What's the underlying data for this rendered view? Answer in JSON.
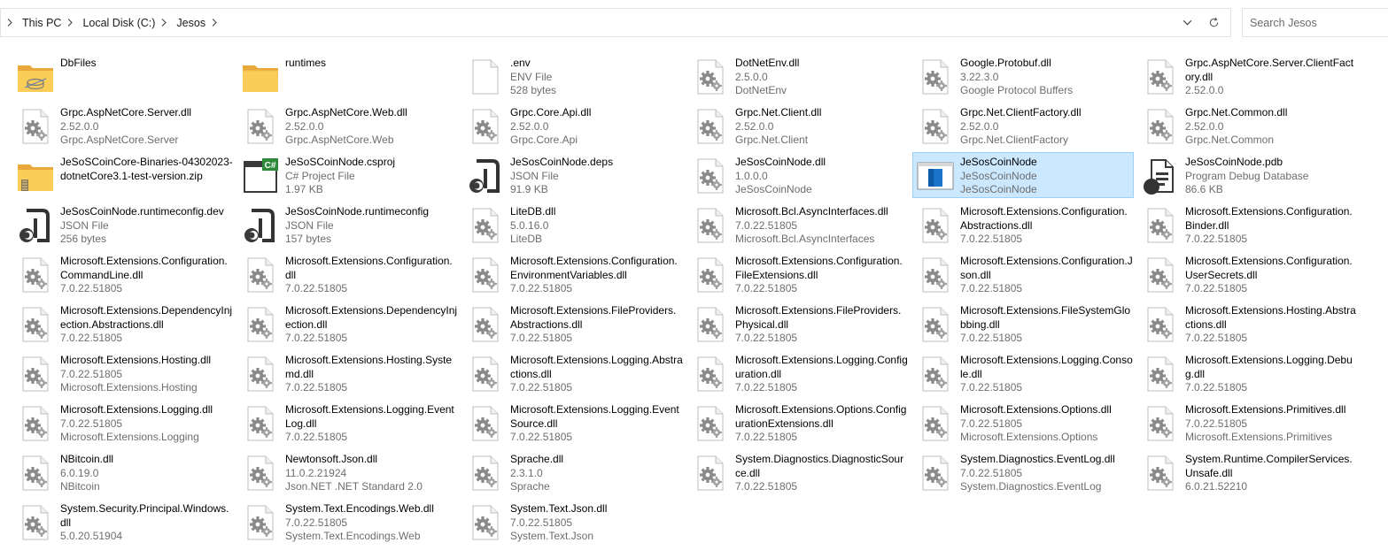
{
  "address": {
    "crumbs": [
      "This PC",
      "Local Disk (C:)",
      "Jesos"
    ],
    "dropdown_icon": "chevron-down-icon",
    "refresh_icon": "refresh-icon"
  },
  "search": {
    "placeholder": "Search Jesos"
  },
  "colors": {
    "selected_bg": "#cce8ff",
    "selected_border": "#99d1ff",
    "folder": "#f5c443",
    "csharp": "#2f8b3a"
  },
  "items": [
    {
      "name": "DbFiles",
      "line2": "",
      "line3": "",
      "icon": "folder-db",
      "iconname": "database-folder-icon"
    },
    {
      "name": "runtimes",
      "line2": "",
      "line3": "",
      "icon": "folder",
      "iconname": "folder-icon"
    },
    {
      "name": ".env",
      "line2": "ENV File",
      "line3": "528 bytes",
      "icon": "blank",
      "iconname": "file-icon"
    },
    {
      "name": "DotNetEnv.dll",
      "line2": "2.5.0.0",
      "line3": "DotNetEnv",
      "icon": "dll",
      "iconname": "dll-gear-icon"
    },
    {
      "name": "Google.Protobuf.dll",
      "line2": "3.22.3.0",
      "line3": "Google Protocol Buffers",
      "icon": "dll",
      "iconname": "dll-gear-icon"
    },
    {
      "name": "Grpc.AspNetCore.Server.ClientFactory.dll",
      "line2": "2.52.0.0",
      "line3": "",
      "icon": "dll",
      "iconname": "dll-gear-icon"
    },
    {
      "name": "Grpc.AspNetCore.Server.dll",
      "line2": "2.52.0.0",
      "line3": "Grpc.AspNetCore.Server",
      "icon": "dll",
      "iconname": "dll-gear-icon"
    },
    {
      "name": "Grpc.AspNetCore.Web.dll",
      "line2": "2.52.0.0",
      "line3": "Grpc.AspNetCore.Web",
      "icon": "dll",
      "iconname": "dll-gear-icon"
    },
    {
      "name": "Grpc.Core.Api.dll",
      "line2": "2.52.0.0",
      "line3": "Grpc.Core.Api",
      "icon": "dll",
      "iconname": "dll-gear-icon"
    },
    {
      "name": "Grpc.Net.Client.dll",
      "line2": "2.52.0.0",
      "line3": "Grpc.Net.Client",
      "icon": "dll",
      "iconname": "dll-gear-icon"
    },
    {
      "name": "Grpc.Net.ClientFactory.dll",
      "line2": "2.52.0.0",
      "line3": "Grpc.Net.ClientFactory",
      "icon": "dll",
      "iconname": "dll-gear-icon"
    },
    {
      "name": "Grpc.Net.Common.dll",
      "line2": "2.52.0.0",
      "line3": "Grpc.Net.Common",
      "icon": "dll",
      "iconname": "dll-gear-icon"
    },
    {
      "name": "JeSoSCoinCore-Binaries-04302023-dotnetCore3.1-test-version.zip",
      "line2": "",
      "line3": "",
      "icon": "zip",
      "iconname": "zip-folder-icon"
    },
    {
      "name": "JeSoSCoinNode.csproj",
      "line2": "C# Project File",
      "line3": "1.97 KB",
      "icon": "csproj",
      "iconname": "csharp-project-icon"
    },
    {
      "name": "JeSosCoinNode.deps",
      "line2": "JSON File",
      "line3": "91.9 KB",
      "icon": "json",
      "iconname": "json-file-icon"
    },
    {
      "name": "JeSosCoinNode.dll",
      "line2": "1.0.0.0",
      "line3": "JeSosCoinNode",
      "icon": "dll",
      "iconname": "dll-gear-icon"
    },
    {
      "name": "JeSosCoinNode",
      "line2": "JeSosCoinNode",
      "line3": "JeSosCoinNode",
      "icon": "exe",
      "iconname": "application-icon",
      "selected": true
    },
    {
      "name": "JeSosCoinNode.pdb",
      "line2": "Program Debug Database",
      "line3": "86.6 KB",
      "icon": "pdb",
      "iconname": "pdb-file-icon"
    },
    {
      "name": "JeSosCoinNode.runtimeconfig.dev",
      "line2": "JSON File",
      "line3": "256 bytes",
      "icon": "json",
      "iconname": "json-file-icon"
    },
    {
      "name": "JeSosCoinNode.runtimeconfig",
      "line2": "JSON File",
      "line3": "157 bytes",
      "icon": "json",
      "iconname": "json-file-icon"
    },
    {
      "name": "LiteDB.dll",
      "line2": "5.0.16.0",
      "line3": "LiteDB",
      "icon": "dll",
      "iconname": "dll-gear-icon"
    },
    {
      "name": "Microsoft.Bcl.AsyncInterfaces.dll",
      "line2": "7.0.22.51805",
      "line3": "Microsoft.Bcl.AsyncInterfaces",
      "icon": "dll",
      "iconname": "dll-gear-icon"
    },
    {
      "name": "Microsoft.Extensions.Configuration.Abstractions.dll",
      "line2": "7.0.22.51805",
      "line3": "",
      "icon": "dll",
      "iconname": "dll-gear-icon"
    },
    {
      "name": "Microsoft.Extensions.Configuration.Binder.dll",
      "line2": "7.0.22.51805",
      "line3": "",
      "icon": "dll",
      "iconname": "dll-gear-icon"
    },
    {
      "name": "Microsoft.Extensions.Configuration.CommandLine.dll",
      "line2": "7.0.22.51805",
      "line3": "",
      "icon": "dll",
      "iconname": "dll-gear-icon"
    },
    {
      "name": "Microsoft.Extensions.Configuration.dll",
      "line2": "7.0.22.51805",
      "line3": "",
      "icon": "dll",
      "iconname": "dll-gear-icon"
    },
    {
      "name": "Microsoft.Extensions.Configuration.EnvironmentVariables.dll",
      "line2": "7.0.22.51805",
      "line3": "",
      "icon": "dll",
      "iconname": "dll-gear-icon"
    },
    {
      "name": "Microsoft.Extensions.Configuration.FileExtensions.dll",
      "line2": "7.0.22.51805",
      "line3": "",
      "icon": "dll",
      "iconname": "dll-gear-icon"
    },
    {
      "name": "Microsoft.Extensions.Configuration.Json.dll",
      "line2": "7.0.22.51805",
      "line3": "",
      "icon": "dll",
      "iconname": "dll-gear-icon"
    },
    {
      "name": "Microsoft.Extensions.Configuration.UserSecrets.dll",
      "line2": "7.0.22.51805",
      "line3": "",
      "icon": "dll",
      "iconname": "dll-gear-icon"
    },
    {
      "name": "Microsoft.Extensions.DependencyInjection.Abstractions.dll",
      "line2": "7.0.22.51805",
      "line3": "",
      "icon": "dll",
      "iconname": "dll-gear-icon"
    },
    {
      "name": "Microsoft.Extensions.DependencyInjection.dll",
      "line2": "7.0.22.51805",
      "line3": "",
      "icon": "dll",
      "iconname": "dll-gear-icon"
    },
    {
      "name": "Microsoft.Extensions.FileProviders.Abstractions.dll",
      "line2": "7.0.22.51805",
      "line3": "",
      "icon": "dll",
      "iconname": "dll-gear-icon"
    },
    {
      "name": "Microsoft.Extensions.FileProviders.Physical.dll",
      "line2": "7.0.22.51805",
      "line3": "",
      "icon": "dll",
      "iconname": "dll-gear-icon"
    },
    {
      "name": "Microsoft.Extensions.FileSystemGlobbing.dll",
      "line2": "7.0.22.51805",
      "line3": "",
      "icon": "dll",
      "iconname": "dll-gear-icon"
    },
    {
      "name": "Microsoft.Extensions.Hosting.Abstractions.dll",
      "line2": "7.0.22.51805",
      "line3": "",
      "icon": "dll",
      "iconname": "dll-gear-icon"
    },
    {
      "name": "Microsoft.Extensions.Hosting.dll",
      "line2": "7.0.22.51805",
      "line3": "Microsoft.Extensions.Hosting",
      "icon": "dll",
      "iconname": "dll-gear-icon"
    },
    {
      "name": "Microsoft.Extensions.Hosting.Systemd.dll",
      "line2": "7.0.22.51805",
      "line3": "",
      "icon": "dll",
      "iconname": "dll-gear-icon"
    },
    {
      "name": "Microsoft.Extensions.Logging.Abstractions.dll",
      "line2": "7.0.22.51805",
      "line3": "",
      "icon": "dll",
      "iconname": "dll-gear-icon"
    },
    {
      "name": "Microsoft.Extensions.Logging.Configuration.dll",
      "line2": "7.0.22.51805",
      "line3": "",
      "icon": "dll",
      "iconname": "dll-gear-icon"
    },
    {
      "name": "Microsoft.Extensions.Logging.Console.dll",
      "line2": "7.0.22.51805",
      "line3": "",
      "icon": "dll",
      "iconname": "dll-gear-icon"
    },
    {
      "name": "Microsoft.Extensions.Logging.Debug.dll",
      "line2": "7.0.22.51805",
      "line3": "",
      "icon": "dll",
      "iconname": "dll-gear-icon"
    },
    {
      "name": "Microsoft.Extensions.Logging.dll",
      "line2": "7.0.22.51805",
      "line3": "Microsoft.Extensions.Logging",
      "icon": "dll",
      "iconname": "dll-gear-icon"
    },
    {
      "name": "Microsoft.Extensions.Logging.EventLog.dll",
      "line2": "7.0.22.51805",
      "line3": "",
      "icon": "dll",
      "iconname": "dll-gear-icon"
    },
    {
      "name": "Microsoft.Extensions.Logging.EventSource.dll",
      "line2": "7.0.22.51805",
      "line3": "",
      "icon": "dll",
      "iconname": "dll-gear-icon"
    },
    {
      "name": "Microsoft.Extensions.Options.ConfigurationExtensions.dll",
      "line2": "7.0.22.51805",
      "line3": "",
      "icon": "dll",
      "iconname": "dll-gear-icon"
    },
    {
      "name": "Microsoft.Extensions.Options.dll",
      "line2": "7.0.22.51805",
      "line3": "Microsoft.Extensions.Options",
      "icon": "dll",
      "iconname": "dll-gear-icon"
    },
    {
      "name": "Microsoft.Extensions.Primitives.dll",
      "line2": "7.0.22.51805",
      "line3": "Microsoft.Extensions.Primitives",
      "icon": "dll",
      "iconname": "dll-gear-icon"
    },
    {
      "name": "NBitcoin.dll",
      "line2": "6.0.19.0",
      "line3": "NBitcoin",
      "icon": "dll",
      "iconname": "dll-gear-icon"
    },
    {
      "name": "Newtonsoft.Json.dll",
      "line2": "11.0.2.21924",
      "line3": "Json.NET .NET Standard 2.0",
      "icon": "dll",
      "iconname": "dll-gear-icon"
    },
    {
      "name": "Sprache.dll",
      "line2": "2.3.1.0",
      "line3": "Sprache",
      "icon": "dll",
      "iconname": "dll-gear-icon"
    },
    {
      "name": "System.Diagnostics.DiagnosticSource.dll",
      "line2": "7.0.22.51805",
      "line3": "",
      "icon": "dll",
      "iconname": "dll-gear-icon"
    },
    {
      "name": "System.Diagnostics.EventLog.dll",
      "line2": "7.0.22.51805",
      "line3": "System.Diagnostics.EventLog",
      "icon": "dll",
      "iconname": "dll-gear-icon"
    },
    {
      "name": "System.Runtime.CompilerServices.Unsafe.dll",
      "line2": "6.0.21.52210",
      "line3": "",
      "icon": "dll",
      "iconname": "dll-gear-icon"
    },
    {
      "name": "System.Security.Principal.Windows.dll",
      "line2": "5.0.20.51904",
      "line3": "",
      "icon": "dll",
      "iconname": "dll-gear-icon"
    },
    {
      "name": "System.Text.Encodings.Web.dll",
      "line2": "7.0.22.51805",
      "line3": "System.Text.Encodings.Web",
      "icon": "dll",
      "iconname": "dll-gear-icon"
    },
    {
      "name": "System.Text.Json.dll",
      "line2": "7.0.22.51805",
      "line3": "System.Text.Json",
      "icon": "dll",
      "iconname": "dll-gear-icon"
    }
  ]
}
